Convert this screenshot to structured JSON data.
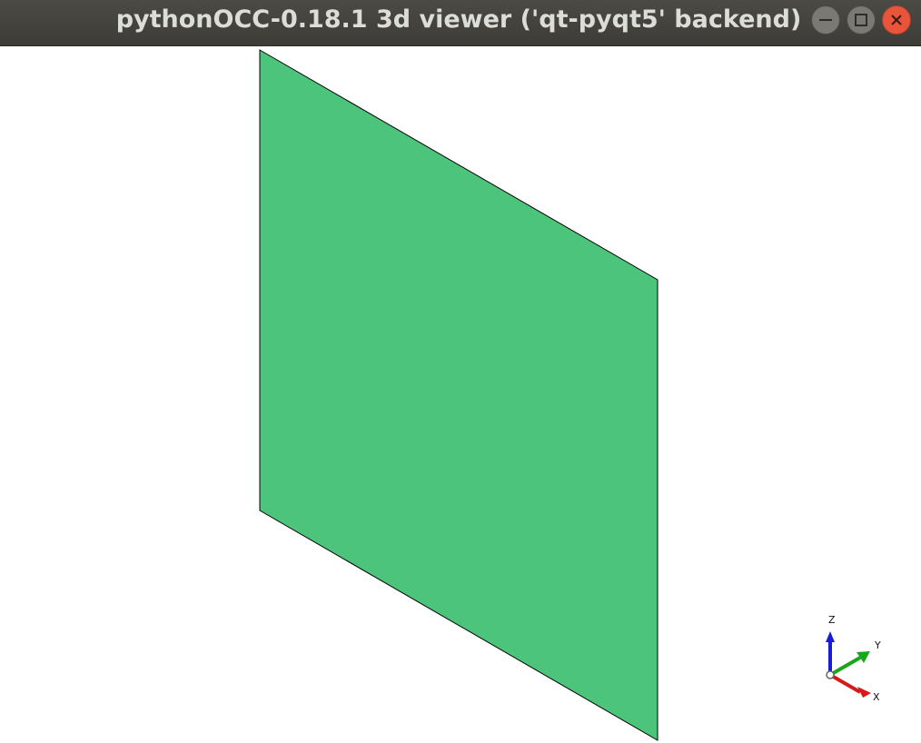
{
  "window": {
    "title": "pythonOCC-0.18.1 3d viewer ('qt-pyqt5' backend)",
    "controls": {
      "minimize": "minimize-icon",
      "maximize": "maximize-icon",
      "close": "close-icon"
    }
  },
  "viewer": {
    "background": "#ffffff",
    "shape": {
      "kind": "planar face",
      "fill": "#4dc47b",
      "edge": "#000000"
    },
    "trihedron": {
      "axes": [
        {
          "label": "Z",
          "color": "#1a1adb"
        },
        {
          "label": "Y",
          "color": "#1aa61a"
        },
        {
          "label": "X",
          "color": "#d61a1a"
        }
      ]
    }
  }
}
